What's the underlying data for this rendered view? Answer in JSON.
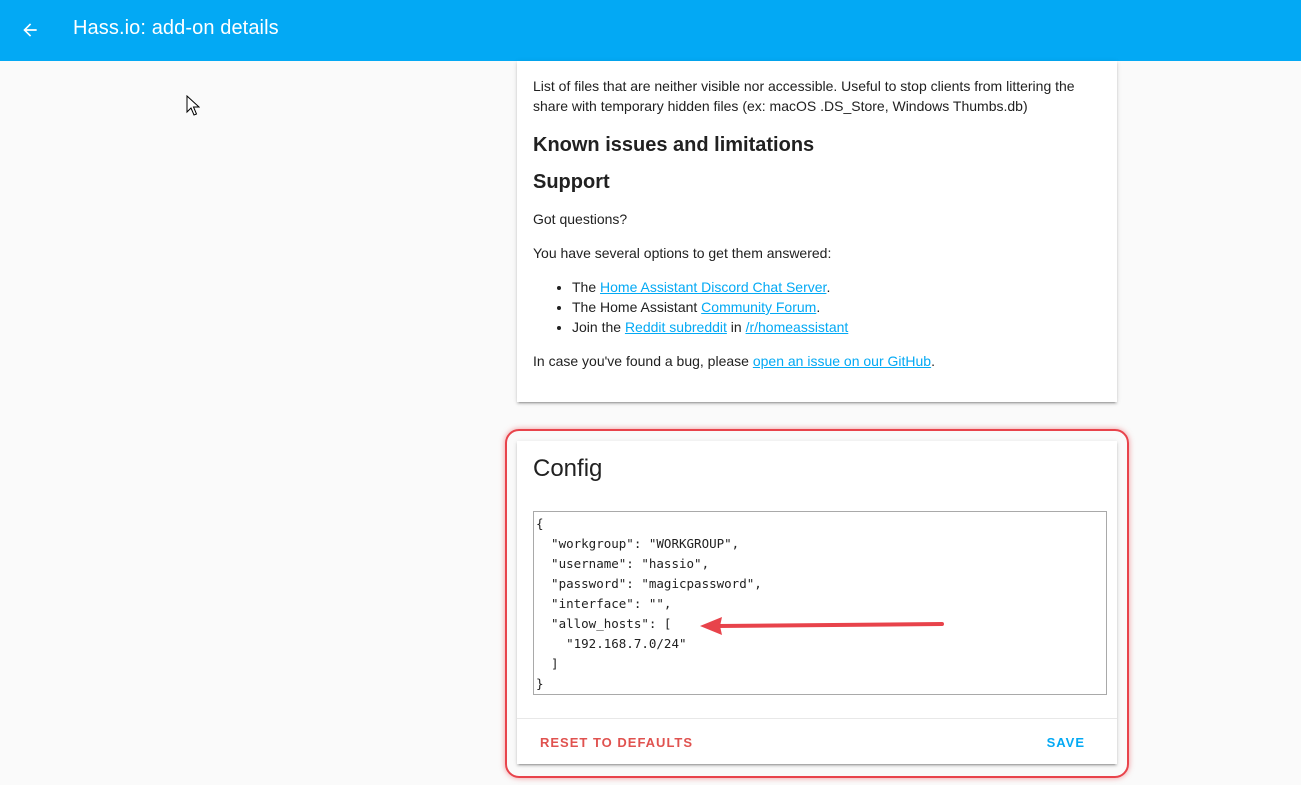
{
  "toolbar": {
    "title": "Hass.io: add-on details",
    "back_icon": "arrow-left-icon",
    "background": "#03a9f4"
  },
  "docs": {
    "intro": "List of files that are neither visible nor accessible. Useful to stop clients from littering the share with temporary hidden files (ex: macOS .DS_Store, Windows Thumbs.db)",
    "heading_known": "Known issues and limitations",
    "heading_support": "Support",
    "questions": "Got questions?",
    "options": "You have several options to get them answered:",
    "list": [
      {
        "prefix": "The ",
        "link": "Home Assistant Discord Chat Server",
        "suffix": "."
      },
      {
        "prefix": "The Home Assistant ",
        "link": "Community Forum",
        "suffix": "."
      },
      {
        "prefix": "Join the ",
        "link": "Reddit subreddit",
        "middle": " in ",
        "link2": "/r/homeassistant"
      }
    ],
    "bug_prefix": "In case you've found a bug, please ",
    "bug_link": "open an issue on our GitHub",
    "bug_suffix": "."
  },
  "config": {
    "title": "Config",
    "value": "{\n  \"workgroup\": \"WORKGROUP\",\n  \"username\": \"hassio\",\n  \"password\": \"magicpassword\",\n  \"interface\": \"\",\n  \"allow_hosts\": [\n    \"192.168.7.0/24\"\n  ]\n}",
    "reset_label": "Reset to defaults",
    "save_label": "Save",
    "reset_color": "#e0524f",
    "save_color": "#03a9f4"
  },
  "annotation": {
    "highlight_color": "#e8434b"
  }
}
